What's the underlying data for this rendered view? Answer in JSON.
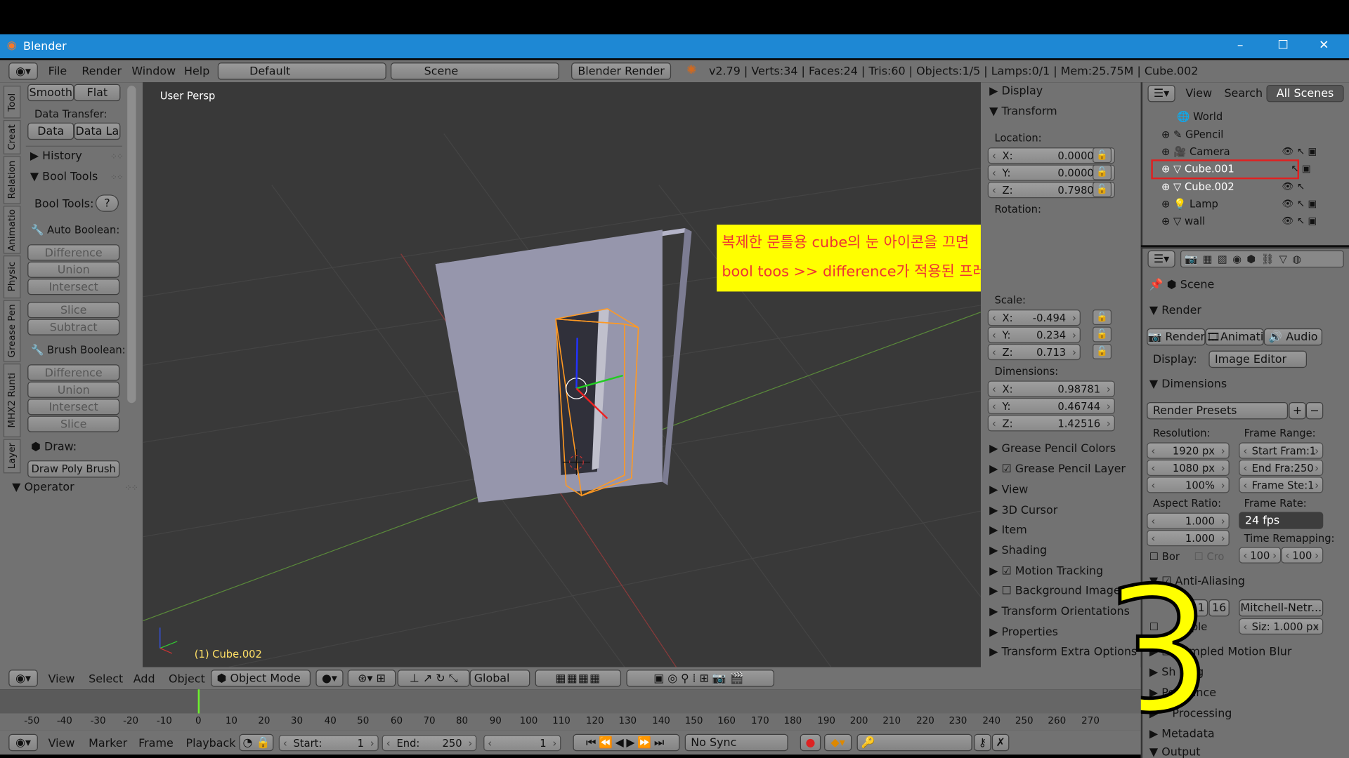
{
  "titlebar": {
    "app": "Blender",
    "min": "–",
    "max": "☐",
    "close": "✕"
  },
  "infobar": {
    "menus": [
      "File",
      "Render",
      "Window",
      "Help"
    ],
    "layout": "Default",
    "scene": "Scene",
    "engine": "Blender Render",
    "stats": "v2.79 | Verts:34 | Faces:24 | Tris:60 | Objects:1/5 | Lamps:0/1 | Mem:25.75M | Cube.002"
  },
  "toolshelf": {
    "tabs": [
      "Tool",
      "Creat",
      "Relation",
      "Animatio",
      "Physic",
      "Grease Pen",
      "MHX2 Runti",
      "Layer"
    ],
    "smooth": "Smooth",
    "flat": "Flat",
    "data_transfer": "Data Transfer:",
    "data": "Data",
    "data_la": "Data La",
    "history": "History",
    "bool_tools": "Bool Tools",
    "bool_tools_label": "Bool Tools:",
    "help": "?",
    "auto_boolean": "Auto Boolean:",
    "auto_items": [
      "Difference",
      "Union",
      "Intersect",
      "Slice",
      "Subtract"
    ],
    "brush_boolean": "Brush Boolean:",
    "brush_items": [
      "Difference",
      "Union",
      "Intersect",
      "Slice"
    ],
    "draw": "Draw:",
    "draw_poly": "Draw Poly Brush",
    "operator": "Operator"
  },
  "viewport": {
    "label": "User Persp",
    "object": "(1) Cube.002"
  },
  "annotation": {
    "line1": "복제한 문틀용 cube의  눈 아이콘을 끄면",
    "line2": "bool toos >> difference가 적용된 프레임이 보인다."
  },
  "big_mark": "3",
  "nprops": {
    "display": "Display",
    "transform": "Transform",
    "location": "Location:",
    "loc": [
      {
        "a": "X:",
        "v": "0.00000"
      },
      {
        "a": "Y:",
        "v": "0.00000"
      },
      {
        "a": "Z:",
        "v": "0.79801"
      }
    ],
    "rotation": "Rotation:",
    "scale": "Scale:",
    "scl": [
      {
        "a": "X:",
        "v": "-0.494"
      },
      {
        "a": "Y:",
        "v": "0.234"
      },
      {
        "a": "Z:",
        "v": "0.713"
      }
    ],
    "dimensions": "Dimensions:",
    "dim": [
      {
        "a": "X:",
        "v": "0.98781"
      },
      {
        "a": "Y:",
        "v": "0.46744"
      },
      {
        "a": "Z:",
        "v": "1.42516"
      }
    ],
    "panels": [
      "Grease Pencil Colors",
      "Grease Pencil Layer",
      "View",
      "3D Cursor",
      "Item",
      "Shading",
      "Motion Tracking",
      "Background Images",
      "Transform Orientations",
      "Properties",
      "Transform Extra Options"
    ]
  },
  "outliner": {
    "view": "View",
    "search": "Search",
    "all_scenes": "All Scenes",
    "items": [
      "World",
      "GPencil",
      "Camera",
      "Cube.001",
      "Cube.002",
      "Lamp",
      "wall"
    ]
  },
  "properties": {
    "scene": "Scene",
    "render": "Render",
    "render_btn": "Render",
    "anim_btn": "Animatio",
    "audio_btn": "Audio",
    "display": "Display:",
    "display_val": "Image Editor",
    "dimensions": "Dimensions",
    "presets": "Render Presets",
    "resolution": "Resolution:",
    "res_x": "1920 px",
    "res_y": "1080 px",
    "res_pct": "100%",
    "frame_range": "Frame Range:",
    "start": "Start Fram:1",
    "end": "End Fra:250",
    "step": "Frame Ste:1",
    "aspect": "Aspect Ratio:",
    "asp_x": "1.000",
    "asp_y": "1.000",
    "frame_rate": "Frame Rate:",
    "fps": "24 fps",
    "time_remap": "Time Remapping:",
    "tr_a": "100",
    "tr_b": "100",
    "bor": "Bor",
    "cro": "Cro",
    "aa": "Anti-Aliasing",
    "aa_11": "11",
    "aa_16": "16",
    "filter": "Mitchell-Netr...",
    "sample": "ample",
    "siz": "Siz: 1.000 px",
    "motion_blur": "Sampled Motion Blur",
    "shading": "Sh ding",
    "performance": "Pe  mance",
    "post": "Processing",
    "metadata": "Metadata",
    "output": "Output"
  },
  "view_header": {
    "menus": [
      "View",
      "Select",
      "Add",
      "Object"
    ],
    "mode": "Object Mode",
    "orient": "Global"
  },
  "timeline": {
    "ticks": [
      "-50",
      "-40",
      "-30",
      "-20",
      "-10",
      "0",
      "10",
      "20",
      "30",
      "40",
      "50",
      "60",
      "70",
      "80",
      "90",
      "100",
      "110",
      "120",
      "130",
      "140",
      "150",
      "160",
      "170",
      "180",
      "190",
      "200",
      "210",
      "220",
      "230",
      "240",
      "250",
      "260",
      "270"
    ],
    "menus": [
      "View",
      "Marker",
      "Frame",
      "Playback"
    ],
    "start": "Start:",
    "start_v": "1",
    "end": "End:",
    "end_v": "250",
    "cur": "1",
    "sync": "No Sync"
  }
}
